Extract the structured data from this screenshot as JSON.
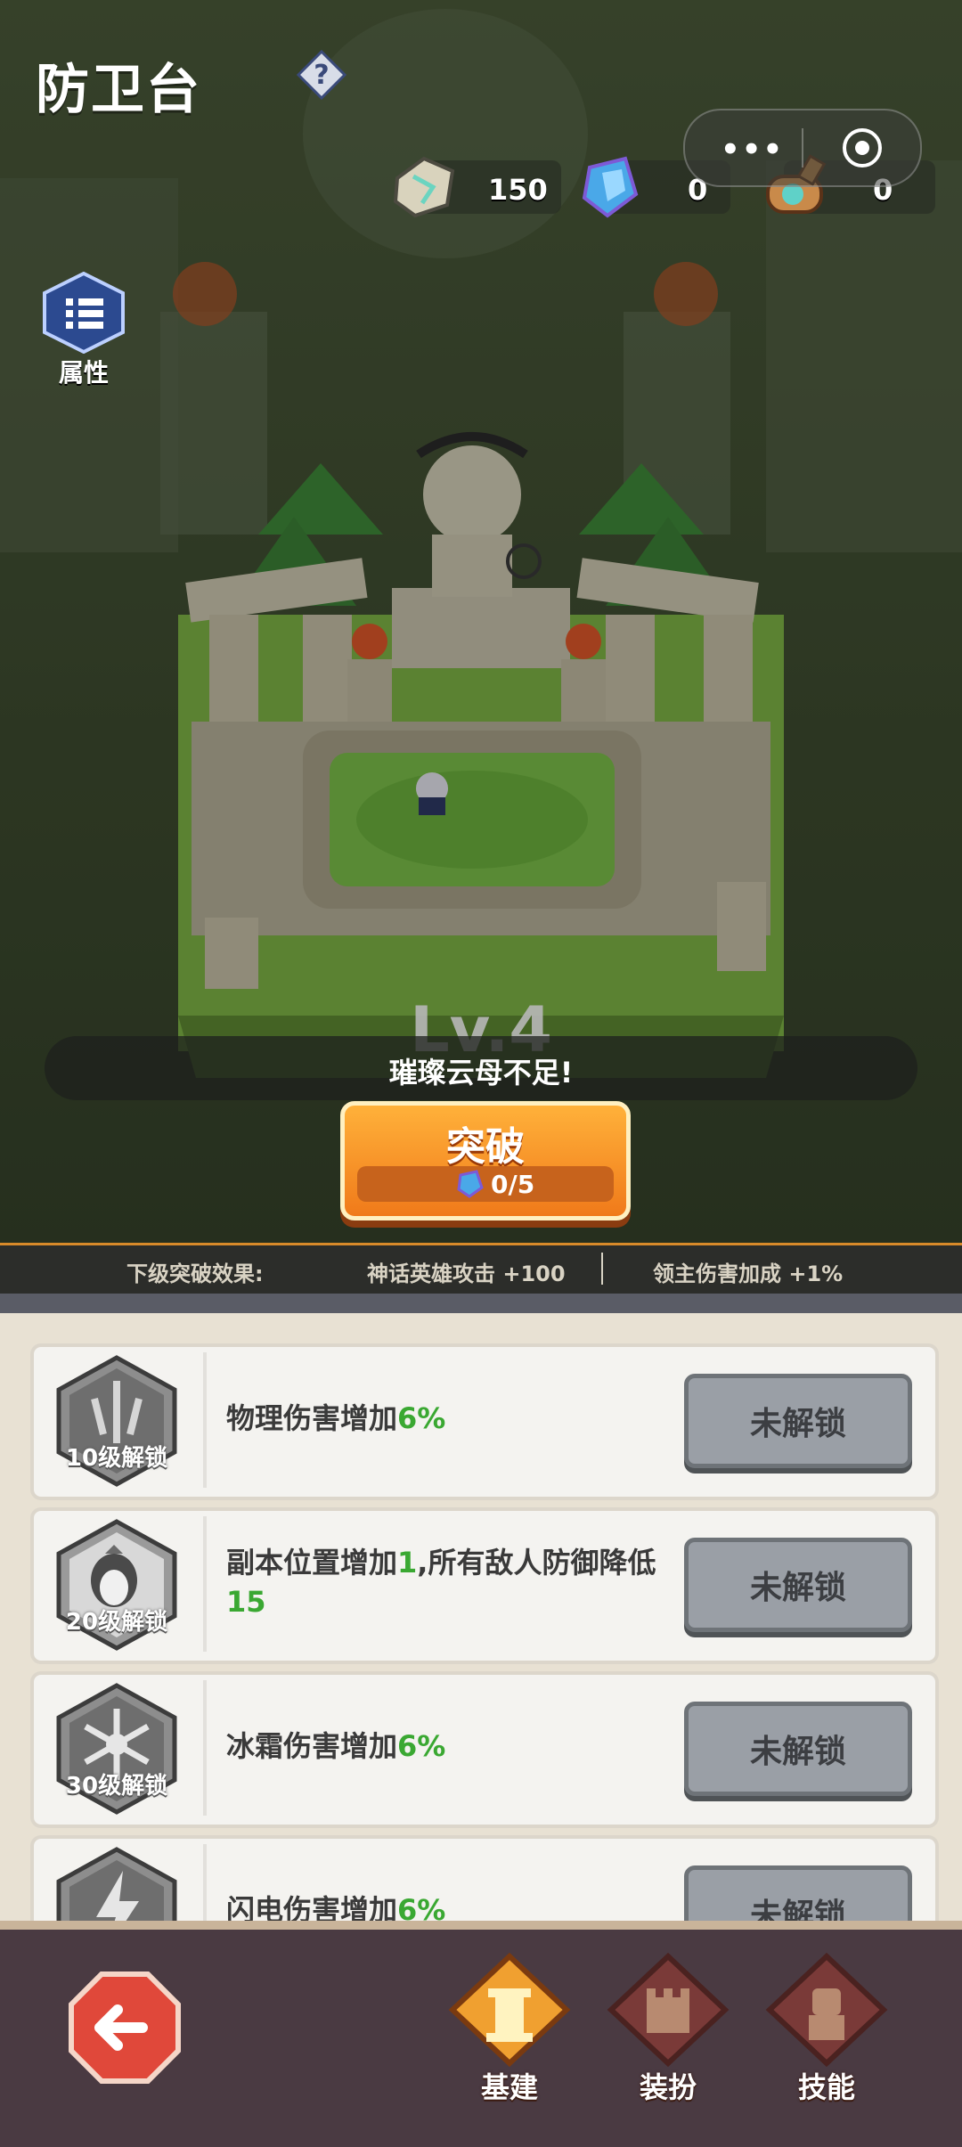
{
  "header": {
    "title": "防卫台"
  },
  "resources": [
    {
      "icon": "stone-icon",
      "value": "150"
    },
    {
      "icon": "crystal-icon",
      "value": "0"
    },
    {
      "icon": "scroll-icon",
      "value": "0"
    }
  ],
  "side": {
    "attributes_label": "属性"
  },
  "scene": {
    "level_text": "Lv.4"
  },
  "toast": {
    "message": "璀璨云母不足!"
  },
  "breakthrough": {
    "label": "突破",
    "cost": "0/5"
  },
  "next_effect": {
    "label": "下级突破效果:",
    "effect1": "神话英雄攻击  +100",
    "effect2": "领主伤害加成  +1%"
  },
  "perks": [
    {
      "unlock_label": "10级解锁",
      "text_parts": [
        "物理伤害增加",
        "6%",
        ""
      ],
      "button": "未解锁"
    },
    {
      "unlock_label": "20级解锁",
      "text_parts": [
        "副本位置增加",
        "1",
        ",所有敌人防御降低",
        "15"
      ],
      "button": "未解锁"
    },
    {
      "unlock_label": "30级解锁",
      "text_parts": [
        "冰霜伤害增加",
        "6%",
        ""
      ],
      "button": "未解锁"
    },
    {
      "unlock_label": "",
      "text_parts": [
        "闪电伤害增加",
        "6%",
        ""
      ],
      "button": "未解锁"
    }
  ],
  "bottom_nav": {
    "items": [
      "基建",
      "装扮",
      "技能"
    ]
  },
  "colors": {
    "accent_orange": "#f07a1a",
    "green_value": "#3aa832",
    "locked_gray": "#9a9fa6"
  }
}
